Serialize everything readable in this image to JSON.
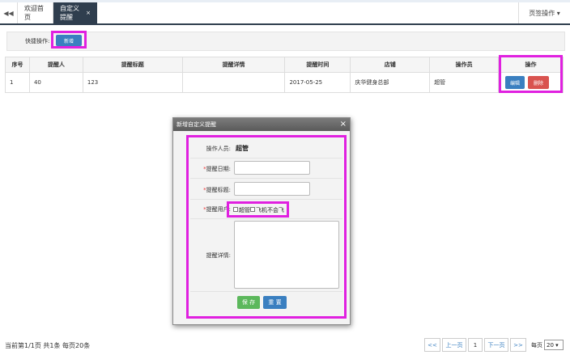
{
  "tabs": {
    "home_label": "欢迎首页",
    "active_label": "自定义提醒",
    "active_close": "×",
    "ops_label": "页签操作 ▾"
  },
  "quick": {
    "label": "快捷操作:",
    "add_label": "新增"
  },
  "table": {
    "headers": [
      "序号",
      "提醒人",
      "提醒标题",
      "提醒详情",
      "提醒时间",
      "店铺",
      "操作员",
      "操作"
    ],
    "rows": [
      {
        "index": "1",
        "person": "40",
        "title": "123",
        "detail": "",
        "time": "2017-05-25",
        "store": "庆华健身总部",
        "operator": "超管"
      }
    ],
    "edit_label": "编辑",
    "delete_label": "删除"
  },
  "modal": {
    "title": "新增自定义提醒",
    "close": "×",
    "operator_label": "操作人员:",
    "operator_value": "超管",
    "date_label": "提醒日期:",
    "title_label": "提醒标题:",
    "users_label": "提醒用户:",
    "user_options": [
      "超管",
      "飞机不会飞"
    ],
    "detail_label": "提醒详情:",
    "required_mark": "*",
    "save_label": "保 存",
    "reset_label": "重 置"
  },
  "footer": {
    "info": "当前第1/1页 共1条 每页20条",
    "first": "<<",
    "prev": "上一页",
    "page": "1",
    "next": "下一页",
    "last": ">>",
    "per_page_label": "每页",
    "per_page_value": "20 ▾"
  },
  "colors": {
    "highlight": "#e020e0",
    "primary": "#3a7fc0",
    "danger": "#d9534f",
    "success": "#5cb85c",
    "tab_dark": "#2f3e4e"
  }
}
